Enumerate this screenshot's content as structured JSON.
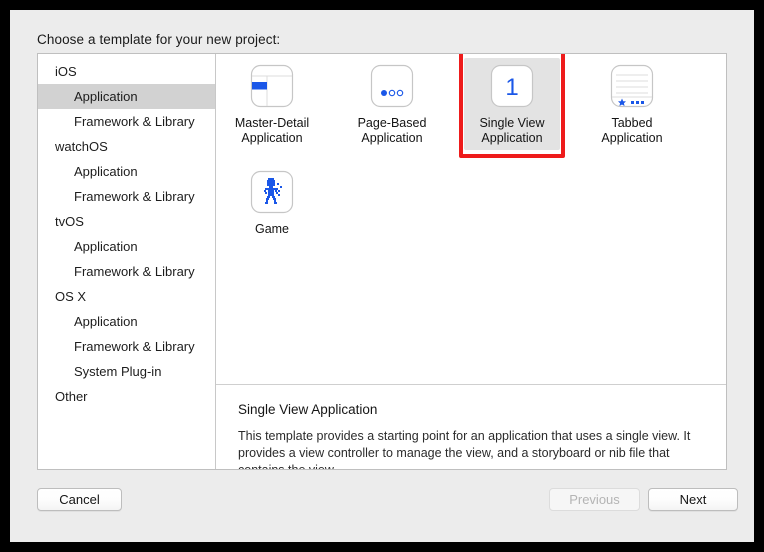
{
  "dialog": {
    "title": "Choose a template for your new project:"
  },
  "sidebar": {
    "items": [
      {
        "label": "iOS",
        "type": "group",
        "selected": false
      },
      {
        "label": "Application",
        "type": "child",
        "selected": true
      },
      {
        "label": "Framework & Library",
        "type": "child",
        "selected": false
      },
      {
        "label": "watchOS",
        "type": "group",
        "selected": false
      },
      {
        "label": "Application",
        "type": "child",
        "selected": false
      },
      {
        "label": "Framework & Library",
        "type": "child",
        "selected": false
      },
      {
        "label": "tvOS",
        "type": "group",
        "selected": false
      },
      {
        "label": "Application",
        "type": "child",
        "selected": false
      },
      {
        "label": "Framework & Library",
        "type": "child",
        "selected": false
      },
      {
        "label": "OS X",
        "type": "group",
        "selected": false
      },
      {
        "label": "Application",
        "type": "child",
        "selected": false
      },
      {
        "label": "Framework & Library",
        "type": "child",
        "selected": false
      },
      {
        "label": "System Plug-in",
        "type": "child",
        "selected": false
      },
      {
        "label": "Other",
        "type": "group",
        "selected": false
      }
    ]
  },
  "templates": [
    {
      "icon": "master-detail-icon",
      "line1": "Master-Detail",
      "line2": "Application",
      "selected": false,
      "highlighted": false
    },
    {
      "icon": "page-based-icon",
      "line1": "Page-Based",
      "line2": "Application",
      "selected": false,
      "highlighted": false
    },
    {
      "icon": "single-view-icon",
      "line1": "Single View",
      "line2": "Application",
      "selected": true,
      "highlighted": true
    },
    {
      "icon": "tabbed-icon",
      "line1": "Tabbed",
      "line2": "Application",
      "selected": false,
      "highlighted": false
    },
    {
      "icon": "game-icon",
      "line1": "Game",
      "line2": "",
      "selected": false,
      "highlighted": false
    }
  ],
  "description": {
    "title": "Single View Application",
    "body": "This template provides a starting point for an application that uses a single view. It provides a view controller to manage the view, and a storyboard or nib file that contains the view."
  },
  "footer": {
    "cancel_label": "Cancel",
    "previous_label": "Previous",
    "next_label": "Next",
    "previous_enabled": false
  },
  "colors": {
    "accent_blue": "#1a57e8",
    "annotation_red": "#ee1b1b",
    "selection_gray": "#d2d2d2",
    "dialog_bg": "#ececec"
  },
  "single_view_icon_number": "1"
}
